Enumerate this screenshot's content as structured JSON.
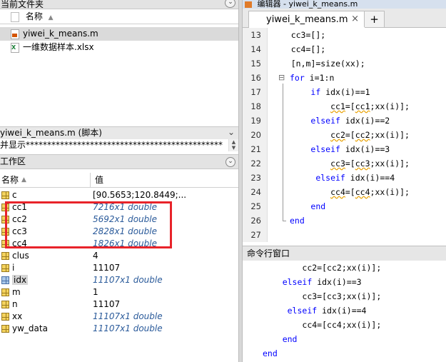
{
  "left": {
    "current_folder": {
      "title": "当前文件夹",
      "col_name": "名称",
      "sort_arrow": "▲",
      "files": [
        {
          "name": "yiwei_k_means.m",
          "type": "m",
          "selected": true
        },
        {
          "name": "一维数据样本.xlsx",
          "type": "xlsx",
          "selected": false
        }
      ]
    },
    "details": {
      "title": "yiwei_k_means.m  (脚本)",
      "text": "并显示**********************************************"
    },
    "workspace": {
      "title": "工作区",
      "col_name": "名称",
      "col_value": "值",
      "sort_arrow": "▲",
      "vars": [
        {
          "name": "c",
          "value": "[90.5653;120.8449;...",
          "italic": false,
          "icon": "grid"
        },
        {
          "name": "cc1",
          "value": "7216x1 double",
          "italic": true,
          "icon": "grid"
        },
        {
          "name": "cc2",
          "value": "5692x1 double",
          "italic": true,
          "icon": "grid"
        },
        {
          "name": "cc3",
          "value": "2828x1 double",
          "italic": true,
          "icon": "grid"
        },
        {
          "name": "cc4",
          "value": "1826x1 double",
          "italic": true,
          "icon": "grid"
        },
        {
          "name": "clus",
          "value": "4",
          "italic": false,
          "icon": "grid"
        },
        {
          "name": "i",
          "value": "11107",
          "italic": false,
          "icon": "grid"
        },
        {
          "name": "idx",
          "value": "11107x1 double",
          "italic": true,
          "icon": "blue"
        },
        {
          "name": "m",
          "value": "1",
          "italic": false,
          "icon": "grid"
        },
        {
          "name": "n",
          "value": "11107",
          "italic": false,
          "icon": "grid"
        },
        {
          "name": "xx",
          "value": "11107x1 double",
          "italic": true,
          "icon": "grid"
        },
        {
          "name": "yw_data",
          "value": "11107x1 double",
          "italic": true,
          "icon": "grid"
        }
      ],
      "highlight_color": "#e8232a"
    }
  },
  "editor": {
    "title": "编辑器 - yiwei_k_means.m",
    "tab_label": "yiwei_k_means.m",
    "tab_close": "×",
    "tab_add": "+",
    "fold_symbol": "⊟",
    "lines": [
      {
        "n": "13",
        "text": "    cc3=[];"
      },
      {
        "n": "14",
        "text": "    cc4=[];"
      },
      {
        "n": "15",
        "text": "    [n,m]=size(xx);"
      },
      {
        "n": "16",
        "text": "for i=1:n"
      },
      {
        "n": "17",
        "text": "        if idx(i)==1"
      },
      {
        "n": "18",
        "text": "            cc1=[cc1;xx(i)];"
      },
      {
        "n": "19",
        "text": "        elseif idx(i)==2"
      },
      {
        "n": "20",
        "text": "            cc2=[cc2;xx(i)];"
      },
      {
        "n": "21",
        "text": "        elseif idx(i)==3"
      },
      {
        "n": "22",
        "text": "            cc3=[cc3;xx(i)];"
      },
      {
        "n": "23",
        "text": "         elseif idx(i)==4"
      },
      {
        "n": "24",
        "text": "            cc4=[cc4;xx(i)];"
      },
      {
        "n": "25",
        "text": "        end"
      },
      {
        "n": "26",
        "text": "end"
      },
      {
        "n": "27",
        "text": ""
      }
    ]
  },
  "command_window": {
    "title": "命令行窗口",
    "lines": [
      "        cc2=[cc2;xx(i)];",
      "    elseif idx(i)==3",
      "        cc3=[cc3;xx(i)];",
      "     elseif idx(i)==4",
      "        cc4=[cc4;xx(i)];",
      "    end",
      "end"
    ]
  }
}
